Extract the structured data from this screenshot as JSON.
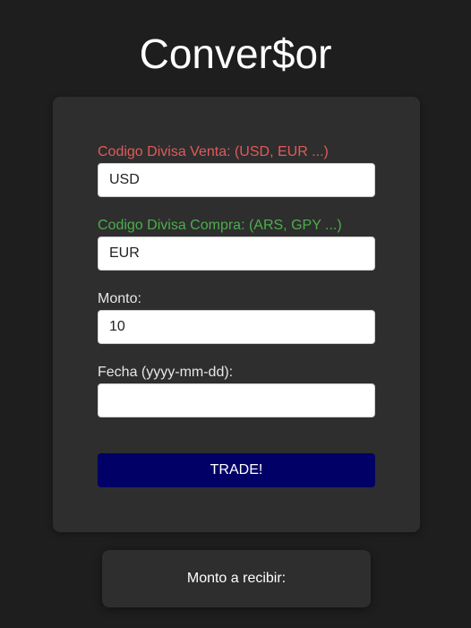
{
  "app": {
    "title": "Conver$or"
  },
  "form": {
    "sell_currency": {
      "label": "Codigo Divisa Venta: (USD, EUR ...)",
      "value": "USD",
      "label_color": "#e05a5a"
    },
    "buy_currency": {
      "label": "Codigo Divisa Compra: (ARS, GPY ...)",
      "value": "EUR",
      "label_color": "#4cae4c"
    },
    "amount": {
      "label": "Monto:",
      "value": "10"
    },
    "date": {
      "label": "Fecha (yyyy-mm-dd):",
      "value": ""
    },
    "trade_button_label": "TRADE!",
    "trade_button_color": "#000066"
  },
  "result": {
    "label": "Monto a recibir:"
  }
}
